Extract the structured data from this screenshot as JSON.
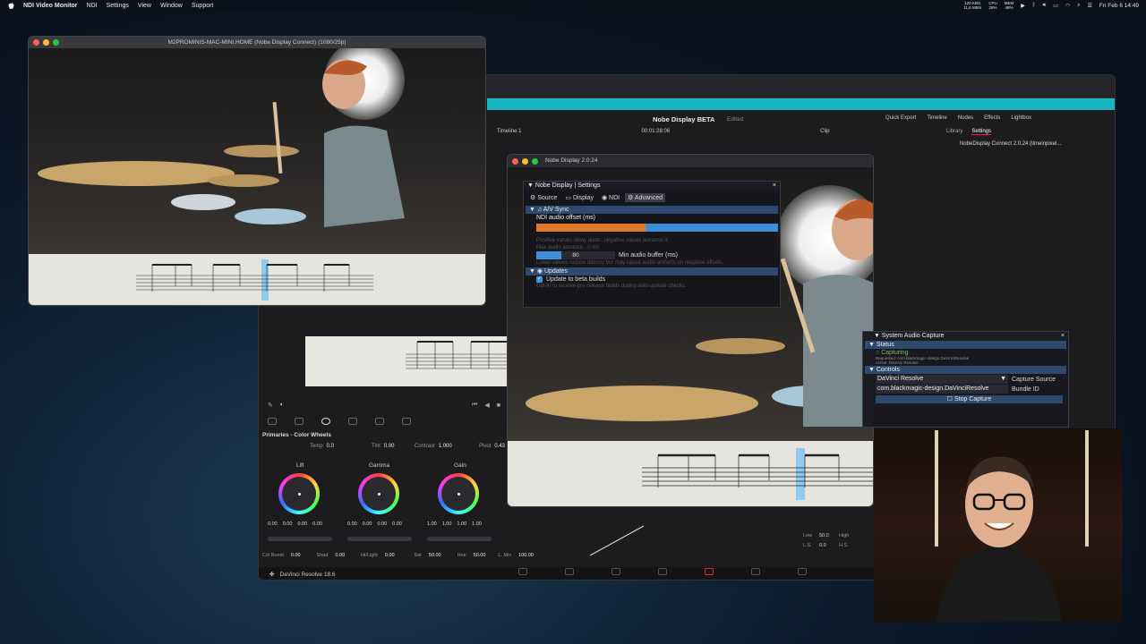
{
  "menubar": {
    "app": "NDI Video Monitor",
    "items": [
      "NDI",
      "Settings",
      "View",
      "Window",
      "Support"
    ],
    "net_up": "120 KB/s",
    "net_down": "11,6 MB/s",
    "cpu_label": "CPU",
    "cpu": "28%",
    "mem_label": "MEM",
    "mem": "48%",
    "clock": "Fri Feb 6  14:49"
  },
  "ndi_window": {
    "title": "M2PROMINIS-MAC-MINI.HOME (Nobe Display Connect) (1080/25p)"
  },
  "resolve": {
    "project": "Nobe Display BETA",
    "edited": "Edited",
    "clock": "Fri Feb 6  14:49",
    "quick_export": "Quick Export",
    "timeline_tab": "Timeline",
    "nodes_tab": "Nodes",
    "effects_tab": "Effects",
    "lightbox_tab": "Lightbox",
    "timeline_name": "Timeline 1",
    "timecode": "00:01:28:06",
    "clip_label": "Clip",
    "library_tab": "Library",
    "settings_tab": "Settings",
    "plugin_name": "NobeDisplay Connect 2.0.24 (timeinpixel...",
    "primaries_title": "Primaries - Color Wheels",
    "temp_label": "Temp",
    "temp": "0.0",
    "tint_label": "Tint",
    "tint": "0.00",
    "contrast_label": "Contrast",
    "contrast": "1.000",
    "pivot_label": "Pivot",
    "pivot": "0.43",
    "lift": "Lift",
    "gamma": "Gamma",
    "gain": "Gain",
    "lift_vals": [
      "0.00",
      "0.00",
      "0.00",
      "0.00"
    ],
    "gamma_vals": [
      "0.00",
      "0.00",
      "0.00",
      "0.00"
    ],
    "gain_vals": [
      "1.00",
      "1.00",
      "1.00",
      "1.00"
    ],
    "colboost_label": "Col Boost",
    "colboost": "0.00",
    "shad_label": "Shad",
    "shad": "0.00",
    "hilight_label": "Hi/Light",
    "hilight": "0.00",
    "sat_label": "Sat",
    "sat": "50.00",
    "hue_label": "Hue",
    "hue": "50.00",
    "lmix_label": "L. Mix",
    "lmix": "100.00",
    "low_label": "Low",
    "low": "50.0",
    "high_label": "High",
    "ls_label": "L.S.",
    "ls": "0.0",
    "hs_label": "H.S.",
    "footer": "DaVinci Resolve 18.6"
  },
  "nobe_window": {
    "title": "Nobe Display 2.0.24"
  },
  "settings_panel": {
    "title": "Nobe Display | Settings",
    "tabs": [
      "Source",
      "Display",
      "NDI",
      "Advanced"
    ],
    "av_sync": "A/V Sync",
    "offset_label": "NDI audio offset (ms)",
    "offset_fraction": 0.45,
    "hint1": "Positive values delay audio; negative values advance it.",
    "hint2": "Max audio advance: -0 ms",
    "buffer_value": "80",
    "buffer_label": "Min audio buffer (ms)",
    "hint3": "Lower values reduce latency but may cause audio artifacts on negative offsets.",
    "updates": "Updates",
    "beta_label": "Update to beta builds",
    "hint4": "Opt-in to receive pre-release builds during auto-update checks."
  },
  "audio_capture": {
    "title": "System Audio Capture",
    "status": "Status",
    "capturing": "Capturing",
    "requested": "Requested: com.blackmagic-design.DaVinciResolve",
    "active": "Active: DaVinci Resolve",
    "controls": "Controls",
    "source_value": "DaVinci Resolve",
    "source_label": "Capture Source",
    "bundle_value": "com.blackmagic-design.DaVinciResolve",
    "bundle_label": "Bundle ID",
    "stop": "Stop Capture"
  }
}
